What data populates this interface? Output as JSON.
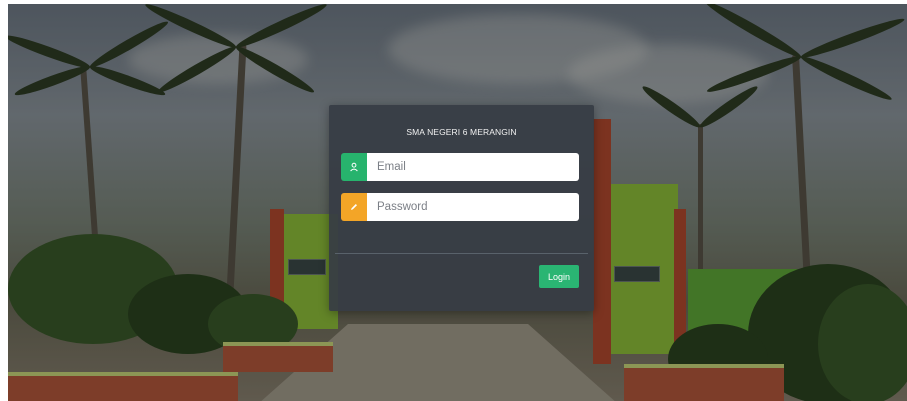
{
  "login": {
    "school_name": "SMA NEGERI 6 MERANGIN",
    "email": {
      "placeholder": "Email",
      "value": "",
      "icon": "user-icon",
      "icon_color": "#27b36d"
    },
    "password": {
      "placeholder": "Password",
      "value": "",
      "icon": "pencil-icon",
      "icon_color": "#f3a527"
    },
    "submit_label": "Login",
    "button_color": "#2ab573",
    "panel_color": "#363c44"
  },
  "background": {
    "description_icon": "school-gate-photo"
  }
}
